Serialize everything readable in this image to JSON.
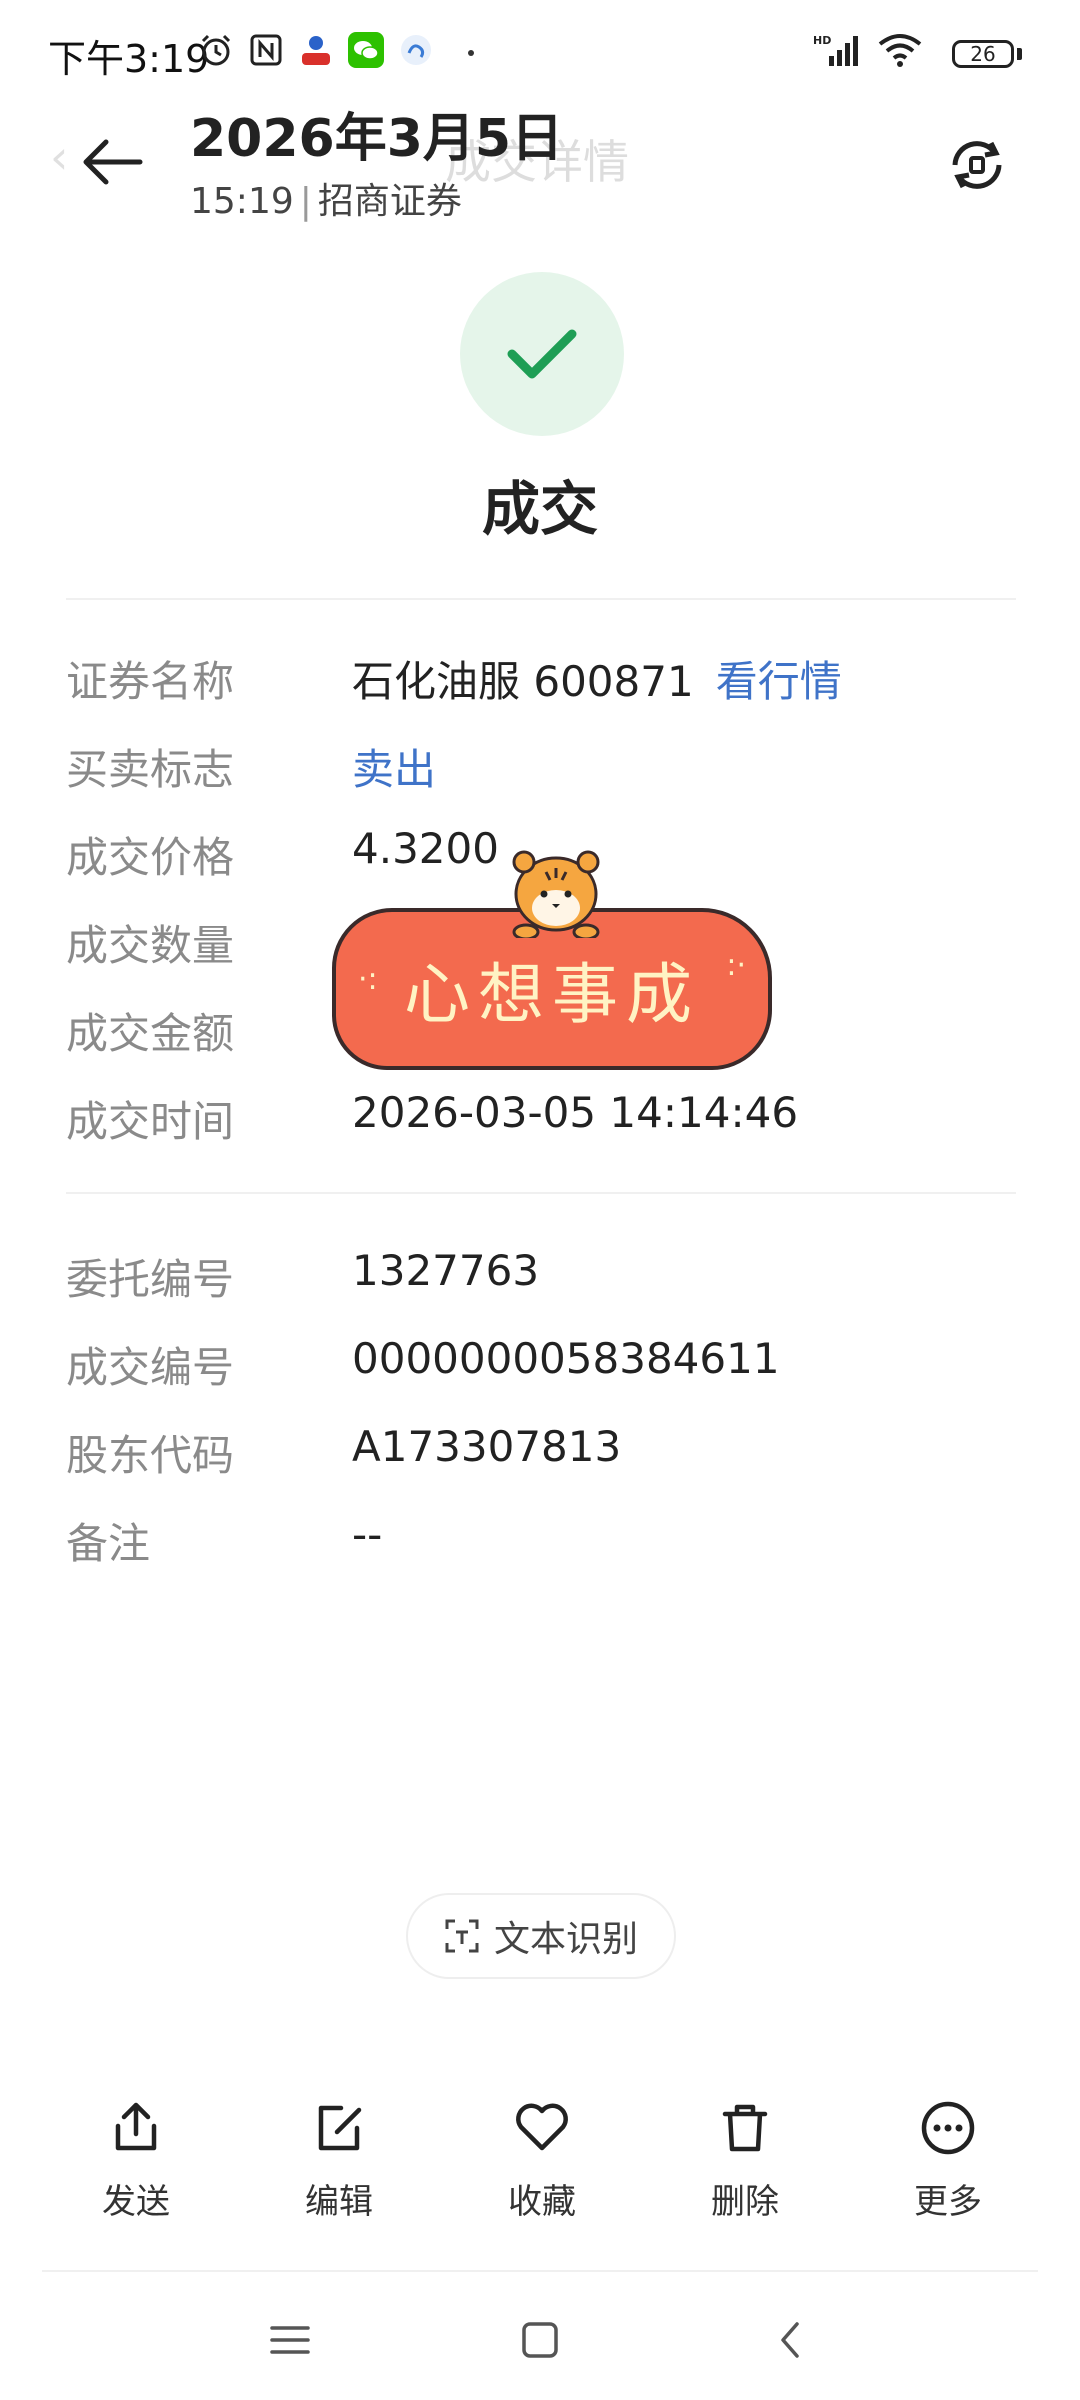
{
  "status_bar": {
    "time": "下午3:19",
    "battery": "26",
    "icons": [
      "alarm-icon",
      "nfc-icon",
      "app-notification-icon",
      "wechat-icon",
      "app-notification-icon",
      "hd-signal-icon",
      "wifi-icon",
      "battery-icon"
    ]
  },
  "header": {
    "date": "2026年3月5日",
    "time": "15:19",
    "source": "招商证券",
    "ghost_title": "成交详情",
    "ghost_back": "‹"
  },
  "status": {
    "title": "成交",
    "accent": "#1e9e55"
  },
  "details": {
    "security_name_label": "证券名称",
    "security_name_value": "石化油服 600871",
    "security_link": "看行情",
    "direction_label": "买卖标志",
    "direction_value": "卖出",
    "price_label": "成交价格",
    "price_value": "4.3200",
    "qty_label": "成交数量",
    "amount_label": "成交金额",
    "time_label": "成交时间",
    "time_value": "2026-03-05 14:14:46"
  },
  "ids": {
    "order_no_label": "委托编号",
    "order_no_value": "1327763",
    "trade_no_label": "成交编号",
    "trade_no_value": "0000000058384611",
    "holder_label": "股东代码",
    "holder_value": "A173307813",
    "remark_label": "备注",
    "remark_value": "--"
  },
  "sticker": {
    "text": "心想事成",
    "banner_color": "#f36a4e"
  },
  "ocr": {
    "label": "文本识别"
  },
  "toolbar": {
    "send": "发送",
    "edit": "编辑",
    "favorite": "收藏",
    "delete": "删除",
    "more": "更多"
  },
  "colors": {
    "link_blue": "#3f73c8",
    "label_gray": "#8a8a8a"
  }
}
